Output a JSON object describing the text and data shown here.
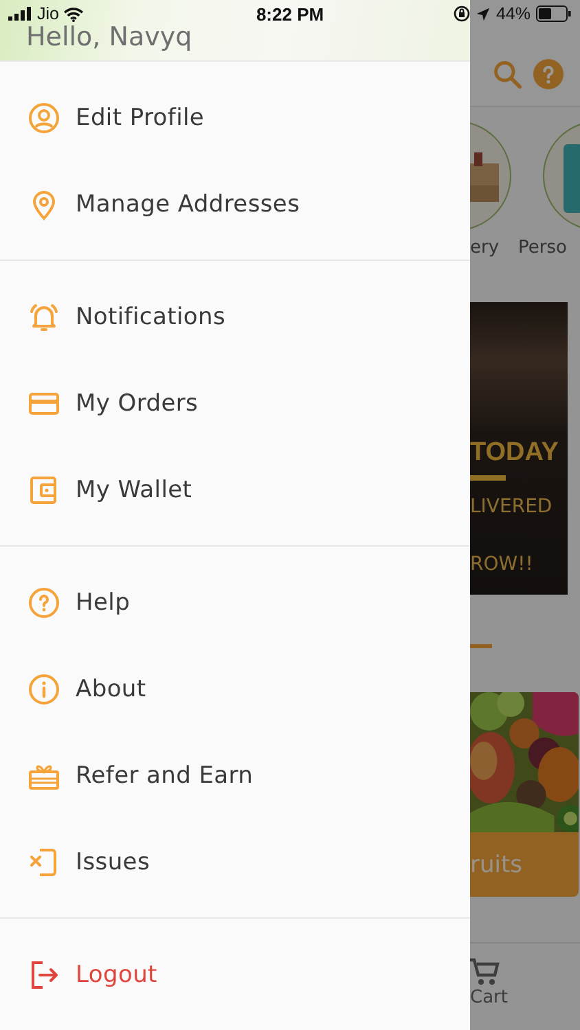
{
  "status_bar": {
    "carrier": "Jio",
    "time": "8:22 PM",
    "battery": "44%"
  },
  "drawer": {
    "greeting": "Hello, Navyq",
    "sections": [
      {
        "items": [
          {
            "label": "Edit Profile",
            "kind": "normal"
          },
          {
            "label": "Manage Addresses",
            "kind": "normal"
          }
        ]
      },
      {
        "items": [
          {
            "label": "Notifications",
            "kind": "normal"
          },
          {
            "label": "My Orders",
            "kind": "normal"
          },
          {
            "label": "My Wallet",
            "kind": "normal"
          }
        ]
      },
      {
        "items": [
          {
            "label": "Help",
            "kind": "normal"
          },
          {
            "label": "About",
            "kind": "normal"
          },
          {
            "label": "Refer and Earn",
            "kind": "normal"
          },
          {
            "label": "Issues",
            "kind": "normal"
          }
        ]
      },
      {
        "items": [
          {
            "label": "Logout",
            "kind": "danger"
          }
        ]
      }
    ]
  },
  "background": {
    "categories": [
      "ery",
      "Perso"
    ],
    "banner": {
      "headline": "TODAY",
      "line_2": "LIVERED",
      "line_3": "ROW!!"
    },
    "tile_label": "ruits",
    "nav_label": "Cart"
  }
}
